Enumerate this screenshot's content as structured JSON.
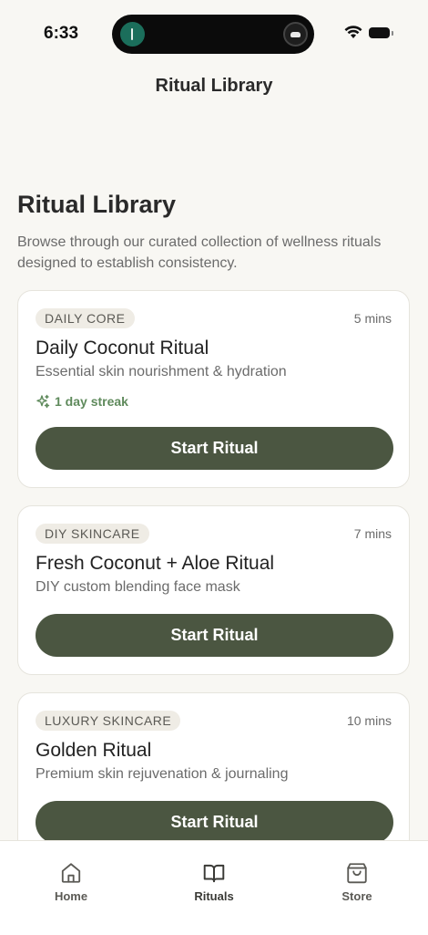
{
  "status_bar": {
    "time": "6:33"
  },
  "header": {
    "title": "Ritual Library"
  },
  "main": {
    "title": "Ritual Library",
    "subtitle": "Browse through our curated collection of wellness rituals designed to establish consistency."
  },
  "rituals": [
    {
      "badge": "DAILY CORE",
      "duration": "5 mins",
      "title": "Daily Coconut Ritual",
      "description": "Essential skin nourishment & hydration",
      "streak": "1 day streak",
      "button_label": "Start Ritual"
    },
    {
      "badge": "DIY SKINCARE",
      "duration": "7 mins",
      "title": "Fresh Coconut + Aloe Ritual",
      "description": "DIY custom blending face mask",
      "button_label": "Start Ritual"
    },
    {
      "badge": "LUXURY SKINCARE",
      "duration": "10 mins",
      "title": "Golden Ritual",
      "description": "Premium skin rejuvenation & journaling",
      "button_label": "Start Ritual"
    }
  ],
  "tab_bar": {
    "tabs": [
      {
        "label": "Home",
        "icon": "home-icon"
      },
      {
        "label": "Rituals",
        "icon": "book-icon",
        "active": true
      },
      {
        "label": "Store",
        "icon": "shopping-bag-icon"
      }
    ]
  },
  "colors": {
    "background": "#f8f7f3",
    "button": "#4b5641",
    "streak": "#5f8a5c",
    "badge_bg": "#efece5"
  }
}
